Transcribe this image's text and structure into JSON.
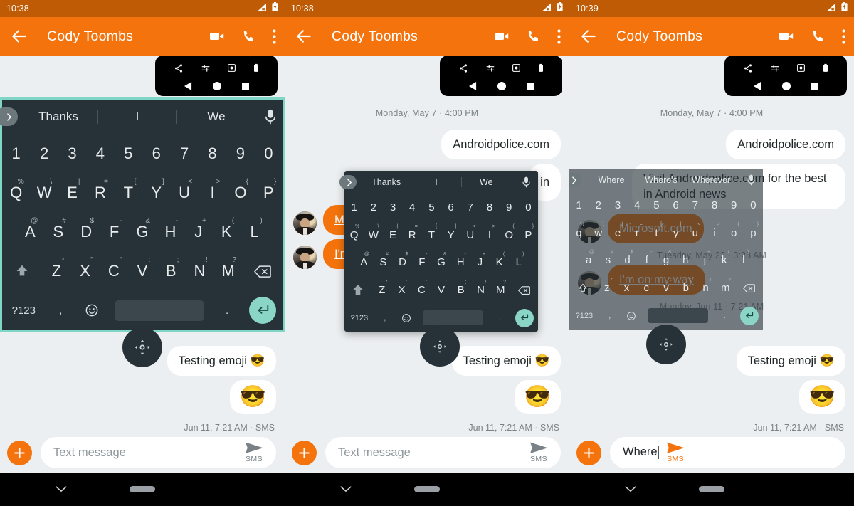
{
  "app": {
    "contact_name": "Cody Toombs",
    "accent_orange": "#f4730c",
    "status_orange": "#bf5b04",
    "keyboard_dark": "#263238",
    "keyboard_accent_teal": "#7fd6c6",
    "background": "#eceff1"
  },
  "panels": [
    {
      "id": "panel-1",
      "status_time": "10:38",
      "title": "Cody Toombs",
      "keyboard": {
        "mode": "full-width-bordered",
        "suggestions": [
          "Thanks",
          "I",
          "We"
        ],
        "numbers": [
          "1",
          "2",
          "3",
          "4",
          "5",
          "6",
          "7",
          "8",
          "9",
          "0"
        ],
        "row_q": [
          "Q",
          "W",
          "E",
          "R",
          "T",
          "Y",
          "U",
          "I",
          "O",
          "P"
        ],
        "row_q_alt": [
          "%",
          "\\",
          "|",
          "=",
          "[",
          "]",
          "<",
          ">",
          "{",
          "}"
        ],
        "row_a": [
          "A",
          "S",
          "D",
          "F",
          "G",
          "H",
          "J",
          "K",
          "L"
        ],
        "row_a_alt": [
          "@",
          "#",
          "$",
          "-",
          "&",
          "-",
          "+",
          "(",
          ")"
        ],
        "row_z": [
          "Z",
          "X",
          "C",
          "V",
          "B",
          "N",
          "M"
        ],
        "row_z_alt": [
          "*",
          "\"",
          "'",
          ":",
          ";",
          "!",
          "?"
        ],
        "sym_key": "?123",
        "comma_key": ",",
        "period_key": ".",
        "case": "upper"
      },
      "messages": [
        {
          "kind": "out",
          "text": "Testing emoji 😎"
        },
        {
          "kind": "out-emoji",
          "text": "😎"
        }
      ],
      "timestamp": "Jun 11, 7:21 AM · SMS",
      "composer": {
        "value": "",
        "placeholder": "Text message",
        "send_label": "SMS",
        "send_active": false
      }
    },
    {
      "id": "panel-2",
      "status_time": "10:38",
      "title": "Cody Toombs",
      "date_divider": "Monday, May 7 · 4:00 PM",
      "keyboard": {
        "mode": "floating",
        "suggestions": [
          "Thanks",
          "I",
          "We"
        ],
        "numbers": [
          "1",
          "2",
          "3",
          "4",
          "5",
          "6",
          "7",
          "8",
          "9",
          "0"
        ],
        "row_q": [
          "Q",
          "W",
          "E",
          "R",
          "T",
          "Y",
          "U",
          "I",
          "O",
          "P"
        ],
        "row_q_alt": [
          "%",
          "\\",
          "|",
          "=",
          "[",
          "]",
          "<",
          ">",
          "{",
          "}"
        ],
        "row_a": [
          "A",
          "S",
          "D",
          "F",
          "G",
          "H",
          "J",
          "K",
          "L"
        ],
        "row_a_alt": [
          "@",
          "#",
          "$",
          "-",
          "&",
          "-",
          "+",
          "(",
          ")"
        ],
        "row_z": [
          "Z",
          "X",
          "C",
          "V",
          "B",
          "N",
          "M"
        ],
        "row_z_alt": [
          "*",
          "\"",
          "'",
          ":",
          ";",
          "!",
          "?"
        ],
        "sym_key": "?123",
        "comma_key": ",",
        "period_key": ".",
        "case": "upper"
      },
      "messages": [
        {
          "kind": "out-link",
          "text": "Androidpolice.com"
        },
        {
          "kind": "out-clipped",
          "text": "in"
        },
        {
          "kind": "in-orange",
          "text": "Mi"
        },
        {
          "kind": "in-orange",
          "text": "I'm"
        },
        {
          "kind": "out",
          "text": "Testing emoji 😎"
        },
        {
          "kind": "out-emoji",
          "text": "😎"
        }
      ],
      "timestamp": "Jun 11, 7:21 AM · SMS",
      "composer": {
        "value": "",
        "placeholder": "Text message",
        "send_label": "SMS",
        "send_active": false
      }
    },
    {
      "id": "panel-3",
      "status_time": "10:39",
      "title": "Cody Toombs",
      "date_divider": "Monday, May 7 · 4:00 PM",
      "keyboard": {
        "mode": "floating-transparent",
        "suggestions": [
          "Where",
          "Where's",
          "Wherever"
        ],
        "numbers": [
          "1",
          "2",
          "3",
          "4",
          "5",
          "6",
          "7",
          "8",
          "9",
          "0"
        ],
        "row_q": [
          "q",
          "w",
          "e",
          "r",
          "t",
          "y",
          "u",
          "i",
          "o",
          "p"
        ],
        "row_q_alt": [
          "%",
          "\\",
          "|",
          "=",
          "[",
          "]",
          "<",
          ">",
          "{",
          "}"
        ],
        "row_a": [
          "a",
          "s",
          "d",
          "f",
          "g",
          "h",
          "j",
          "k",
          "l"
        ],
        "row_a_alt": [
          "@",
          "#",
          "$",
          "-",
          "&",
          "-",
          "+",
          "(",
          ")"
        ],
        "row_z": [
          "z",
          "x",
          "c",
          "v",
          "b",
          "n",
          "m"
        ],
        "row_z_alt": [
          "*",
          "\"",
          "'",
          ":",
          ";",
          "!",
          "?"
        ],
        "sym_key": "?123",
        "comma_key": ",",
        "period_key": ".",
        "case": "lower"
      },
      "messages": [
        {
          "kind": "out-link",
          "text": "Androidpolice.com"
        },
        {
          "kind": "out-long",
          "text": "Visit Androidpolice.com for the best in Android news"
        },
        {
          "kind": "in-orange",
          "text": "Microsoft.com"
        },
        {
          "kind": "in-orange",
          "text": "I'm on my way"
        },
        {
          "kind": "out",
          "text": "Testing emoji 😎"
        },
        {
          "kind": "out-emoji",
          "text": "😎"
        }
      ],
      "behind_dividers": [
        "Tuesday, May 22 · 3:28 AM",
        "Monday, Jun 11 · 7:21 AM"
      ],
      "timestamp": "Jun 11, 7:21 AM · SMS",
      "composer": {
        "value": "Where",
        "placeholder": "Text message",
        "send_label": "SMS",
        "send_active": true
      }
    }
  ],
  "icons": {
    "back": "arrow-back-icon",
    "video": "video-call-icon",
    "call": "phone-icon",
    "overflow": "more-vert-icon",
    "share": "share-icon",
    "markup": "markup-icon",
    "save": "save-icon",
    "delete": "delete-icon",
    "nav_back": "triangle-back-icon",
    "nav_home": "circle-home-icon",
    "nav_recents": "square-recents-icon",
    "mic": "mic-icon",
    "shift": "shift-arrow-icon",
    "backspace": "backspace-icon",
    "emoji": "emoji-icon",
    "enter": "enter-return-icon",
    "expand": "chevron-right-icon",
    "move": "move-handle-icon",
    "plus": "plus-icon",
    "send": "send-icon",
    "chevron_down": "chevron-down-icon",
    "signal": "signal-off-icon",
    "battery": "battery-charging-icon"
  }
}
